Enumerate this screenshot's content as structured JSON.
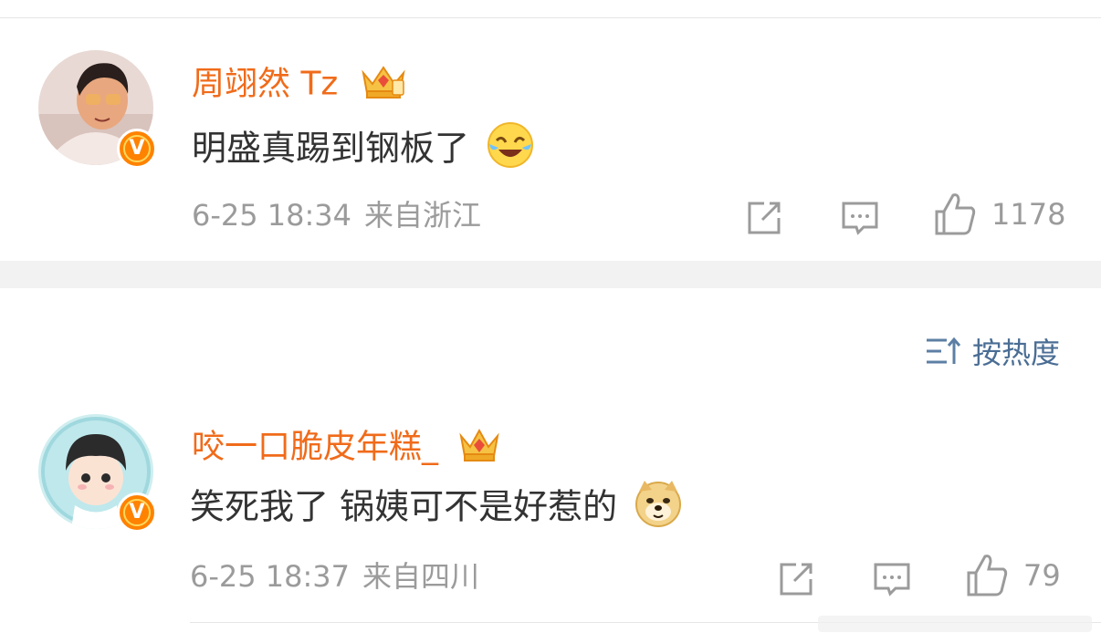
{
  "comments": [
    {
      "username": "周翊然 Tz",
      "content": "明盛真踢到钢板了",
      "emoji": "laughing-crying",
      "date": "6-25 18:34",
      "location": "来自浙江",
      "likes": "1178"
    },
    {
      "username": "咬一口脆皮年糕_",
      "content": "笑死我了 锅姨可不是好惹的",
      "emoji": "doge",
      "date": "6-25 18:37",
      "location": "来自四川",
      "likes": "79"
    }
  ],
  "sort": {
    "label": "按热度",
    "icon": "sort-icon"
  },
  "colors": {
    "username": "#f06b1a",
    "meta": "#9b9b9b",
    "sort": "#4a6d94",
    "badge": "#ff8200"
  }
}
